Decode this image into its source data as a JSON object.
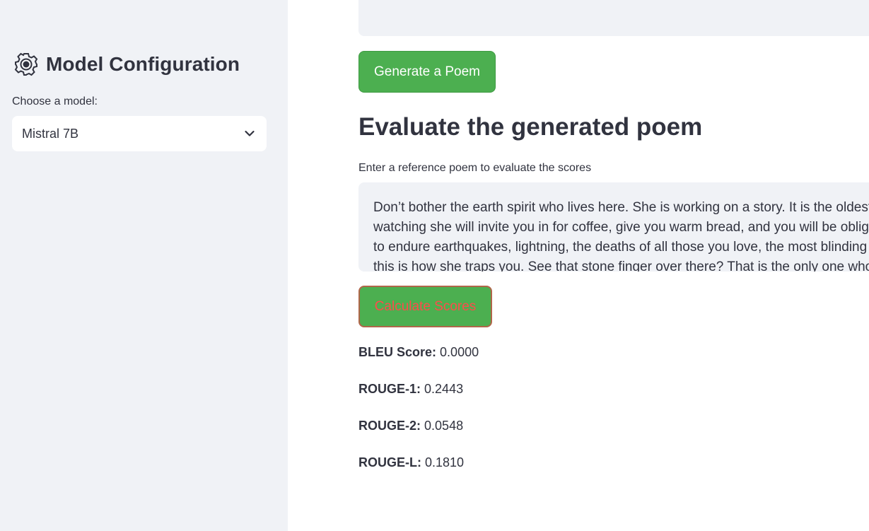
{
  "sidebar": {
    "title": "Model Configuration",
    "title_icon": "gear-icon",
    "model_label": "Choose a model:",
    "model_selected": "Mistral 7B",
    "dropdown_icon": "chevron-down-icon"
  },
  "main": {
    "generate_button": "Generate a Poem",
    "evaluate_title": "Evaluate the generated poem",
    "reference_label": "Enter a reference poem to evaluate the scores",
    "reference_lines": [
      "Don’t bother the earth spirit who lives here. She is working on a story. It is the oldest story in the world",
      "watching she will invite you in for coffee, give you warm bread, and you will be obligated to stay and listen",
      "to endure earthquakes, lightning, the deaths of all those you love, the most blinding sadness. The story",
      "this is how she traps you. See that stone finger over there? That is the only one who ever escaped."
    ],
    "calculate_button": "Calculate Scores",
    "scores": [
      {
        "label": "BLEU Score:",
        "value": "0.0000"
      },
      {
        "label": "ROUGE-1:",
        "value": "0.2443"
      },
      {
        "label": "ROUGE-2:",
        "value": "0.0548"
      },
      {
        "label": "ROUGE-L:",
        "value": "0.1810"
      }
    ]
  },
  "colors": {
    "sidebar_bg": "#f0f2f6",
    "button_green": "#4caf50",
    "calc_button_text": "#ff4b4b",
    "text": "#31333f"
  }
}
